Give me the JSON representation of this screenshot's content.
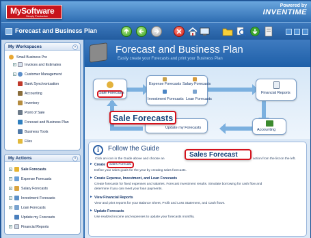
{
  "brand": {
    "name": "MySoftware",
    "tagline": "Simply Productive",
    "powered_line1": "Powered by",
    "powered_line2": "INVENTIME"
  },
  "titlebar": {
    "title": "Forecast and Business Plan"
  },
  "workspaces": {
    "header": "My Workspaces",
    "items": [
      "Small Business Pro",
      "Invoices and Estimates",
      "Customer Management",
      "Bank Synchronization",
      "Accounting",
      "Inventory",
      "Point of Sale",
      "Forecast and Business Plan",
      "Business Tools",
      "Files"
    ]
  },
  "actions": {
    "header": "My Actions",
    "items": [
      "Sale Forecasts",
      "Expense Forecasts",
      "Salary Forecasts",
      "Investment Forecasts",
      "Loan Forecasts",
      "Update my Forecasts",
      "Financial Reports"
    ]
  },
  "main": {
    "title": "Forecast and Business Plan",
    "subtitle": "Easily create your Forecasts and print your Business Plan"
  },
  "flow": {
    "sale": "Sale Forecasts",
    "expense": "Expense Forecasts",
    "salary": "Salary Forecasts",
    "investment": "Investment Forecasts",
    "loan": "Loan Forecasts",
    "financial": "Financial Reports",
    "update": "Update my Forecasts",
    "accounting": "Accounting",
    "callout": "Sale Forecasts"
  },
  "guide": {
    "title": "Follow the Guide",
    "intro_left": "Click an icon in the Guide above and choose an",
    "intro_right": "action from the list on the left.",
    "callout": "Sales Forecast",
    "create_label": "Create",
    "create_link": "Sales Forecast",
    "create_desc": "Define your sales goals for the year by creating sales forecasts.",
    "s2_title": "Create Expense, Investment, and Loan Forecasts",
    "s2_desc1": "Create forecasts for fixed expenses and salaries. Forecast investment results. Simulate borrowing for cash flow and",
    "s2_desc2": "determine if you can meet your loan payments.",
    "s3_title": "View Financial Reports",
    "s3_desc": "View and print reports for your Balance Sheet, Profit and Loss Statement, and Cash flows.",
    "s4_title": "Update Forecasts",
    "s4_desc": "Use realized income and expenses to update your forecasts monthly."
  },
  "colors": {
    "accent_red": "#d5131d",
    "header_blue": "#2e6db2",
    "panel_bg": "#c9daee"
  }
}
